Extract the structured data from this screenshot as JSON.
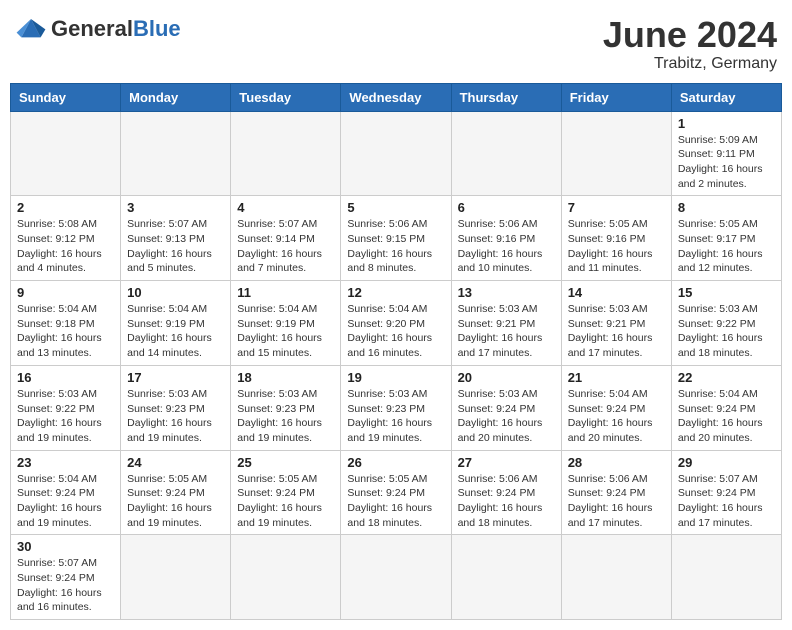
{
  "header": {
    "logo_general": "General",
    "logo_blue": "Blue",
    "month_title": "June 2024",
    "subtitle": "Trabitz, Germany"
  },
  "weekdays": [
    "Sunday",
    "Monday",
    "Tuesday",
    "Wednesday",
    "Thursday",
    "Friday",
    "Saturday"
  ],
  "weeks": [
    [
      {
        "day": "",
        "info": ""
      },
      {
        "day": "",
        "info": ""
      },
      {
        "day": "",
        "info": ""
      },
      {
        "day": "",
        "info": ""
      },
      {
        "day": "",
        "info": ""
      },
      {
        "day": "",
        "info": ""
      },
      {
        "day": "1",
        "info": "Sunrise: 5:09 AM\nSunset: 9:11 PM\nDaylight: 16 hours\nand 2 minutes."
      }
    ],
    [
      {
        "day": "2",
        "info": "Sunrise: 5:08 AM\nSunset: 9:12 PM\nDaylight: 16 hours\nand 4 minutes."
      },
      {
        "day": "3",
        "info": "Sunrise: 5:07 AM\nSunset: 9:13 PM\nDaylight: 16 hours\nand 5 minutes."
      },
      {
        "day": "4",
        "info": "Sunrise: 5:07 AM\nSunset: 9:14 PM\nDaylight: 16 hours\nand 7 minutes."
      },
      {
        "day": "5",
        "info": "Sunrise: 5:06 AM\nSunset: 9:15 PM\nDaylight: 16 hours\nand 8 minutes."
      },
      {
        "day": "6",
        "info": "Sunrise: 5:06 AM\nSunset: 9:16 PM\nDaylight: 16 hours\nand 10 minutes."
      },
      {
        "day": "7",
        "info": "Sunrise: 5:05 AM\nSunset: 9:16 PM\nDaylight: 16 hours\nand 11 minutes."
      },
      {
        "day": "8",
        "info": "Sunrise: 5:05 AM\nSunset: 9:17 PM\nDaylight: 16 hours\nand 12 minutes."
      }
    ],
    [
      {
        "day": "9",
        "info": "Sunrise: 5:04 AM\nSunset: 9:18 PM\nDaylight: 16 hours\nand 13 minutes."
      },
      {
        "day": "10",
        "info": "Sunrise: 5:04 AM\nSunset: 9:19 PM\nDaylight: 16 hours\nand 14 minutes."
      },
      {
        "day": "11",
        "info": "Sunrise: 5:04 AM\nSunset: 9:19 PM\nDaylight: 16 hours\nand 15 minutes."
      },
      {
        "day": "12",
        "info": "Sunrise: 5:04 AM\nSunset: 9:20 PM\nDaylight: 16 hours\nand 16 minutes."
      },
      {
        "day": "13",
        "info": "Sunrise: 5:03 AM\nSunset: 9:21 PM\nDaylight: 16 hours\nand 17 minutes."
      },
      {
        "day": "14",
        "info": "Sunrise: 5:03 AM\nSunset: 9:21 PM\nDaylight: 16 hours\nand 17 minutes."
      },
      {
        "day": "15",
        "info": "Sunrise: 5:03 AM\nSunset: 9:22 PM\nDaylight: 16 hours\nand 18 minutes."
      }
    ],
    [
      {
        "day": "16",
        "info": "Sunrise: 5:03 AM\nSunset: 9:22 PM\nDaylight: 16 hours\nand 19 minutes."
      },
      {
        "day": "17",
        "info": "Sunrise: 5:03 AM\nSunset: 9:23 PM\nDaylight: 16 hours\nand 19 minutes."
      },
      {
        "day": "18",
        "info": "Sunrise: 5:03 AM\nSunset: 9:23 PM\nDaylight: 16 hours\nand 19 minutes."
      },
      {
        "day": "19",
        "info": "Sunrise: 5:03 AM\nSunset: 9:23 PM\nDaylight: 16 hours\nand 19 minutes."
      },
      {
        "day": "20",
        "info": "Sunrise: 5:03 AM\nSunset: 9:24 PM\nDaylight: 16 hours\nand 20 minutes."
      },
      {
        "day": "21",
        "info": "Sunrise: 5:04 AM\nSunset: 9:24 PM\nDaylight: 16 hours\nand 20 minutes."
      },
      {
        "day": "22",
        "info": "Sunrise: 5:04 AM\nSunset: 9:24 PM\nDaylight: 16 hours\nand 20 minutes."
      }
    ],
    [
      {
        "day": "23",
        "info": "Sunrise: 5:04 AM\nSunset: 9:24 PM\nDaylight: 16 hours\nand 19 minutes."
      },
      {
        "day": "24",
        "info": "Sunrise: 5:05 AM\nSunset: 9:24 PM\nDaylight: 16 hours\nand 19 minutes."
      },
      {
        "day": "25",
        "info": "Sunrise: 5:05 AM\nSunset: 9:24 PM\nDaylight: 16 hours\nand 19 minutes."
      },
      {
        "day": "26",
        "info": "Sunrise: 5:05 AM\nSunset: 9:24 PM\nDaylight: 16 hours\nand 18 minutes."
      },
      {
        "day": "27",
        "info": "Sunrise: 5:06 AM\nSunset: 9:24 PM\nDaylight: 16 hours\nand 18 minutes."
      },
      {
        "day": "28",
        "info": "Sunrise: 5:06 AM\nSunset: 9:24 PM\nDaylight: 16 hours\nand 17 minutes."
      },
      {
        "day": "29",
        "info": "Sunrise: 5:07 AM\nSunset: 9:24 PM\nDaylight: 16 hours\nand 17 minutes."
      }
    ],
    [
      {
        "day": "30",
        "info": "Sunrise: 5:07 AM\nSunset: 9:24 PM\nDaylight: 16 hours\nand 16 minutes."
      },
      {
        "day": "",
        "info": ""
      },
      {
        "day": "",
        "info": ""
      },
      {
        "day": "",
        "info": ""
      },
      {
        "day": "",
        "info": ""
      },
      {
        "day": "",
        "info": ""
      },
      {
        "day": "",
        "info": ""
      }
    ]
  ]
}
